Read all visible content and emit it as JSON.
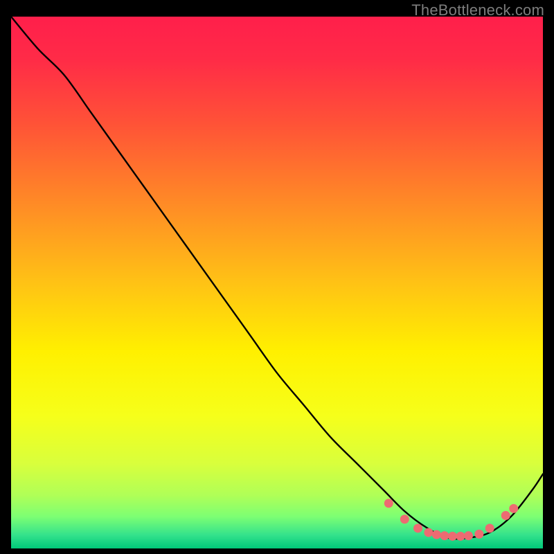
{
  "watermark": "TheBottleneck.com",
  "chart_data": {
    "type": "line",
    "title": "",
    "xlabel": "",
    "ylabel": "",
    "xlim": [
      0,
      100
    ],
    "ylim": [
      0,
      100
    ],
    "grid": false,
    "legend": false,
    "series": [
      {
        "name": "curve",
        "x": [
          0,
          5,
          10,
          15,
          20,
          25,
          30,
          35,
          40,
          45,
          50,
          55,
          60,
          65,
          70,
          74,
          78,
          82,
          86,
          90,
          94,
          98,
          100
        ],
        "y": [
          100,
          94,
          89,
          82,
          75,
          68,
          61,
          54,
          47,
          40,
          33,
          27,
          21,
          16,
          11,
          7,
          4,
          2,
          2,
          3,
          6,
          11,
          14
        ]
      }
    ],
    "markers": {
      "name": "dots",
      "color": "#ed6b72",
      "x": [
        71,
        74,
        76.5,
        78.5,
        80,
        81.5,
        83,
        84.5,
        86,
        88,
        90,
        93,
        94.5
      ],
      "y": [
        8.5,
        5.5,
        3.8,
        3.0,
        2.6,
        2.4,
        2.3,
        2.3,
        2.4,
        2.7,
        3.8,
        6.2,
        7.5
      ]
    },
    "gradient_stops": [
      {
        "offset": 0.0,
        "color": "#ff1f4b"
      },
      {
        "offset": 0.08,
        "color": "#ff2b47"
      },
      {
        "offset": 0.2,
        "color": "#ff5237"
      },
      {
        "offset": 0.35,
        "color": "#ff8a26"
      },
      {
        "offset": 0.5,
        "color": "#ffc215"
      },
      {
        "offset": 0.63,
        "color": "#fff000"
      },
      {
        "offset": 0.75,
        "color": "#f6ff1a"
      },
      {
        "offset": 0.84,
        "color": "#d9ff3c"
      },
      {
        "offset": 0.9,
        "color": "#b0ff57"
      },
      {
        "offset": 0.94,
        "color": "#7dff73"
      },
      {
        "offset": 0.975,
        "color": "#33e28c"
      },
      {
        "offset": 1.0,
        "color": "#00c97a"
      }
    ]
  }
}
